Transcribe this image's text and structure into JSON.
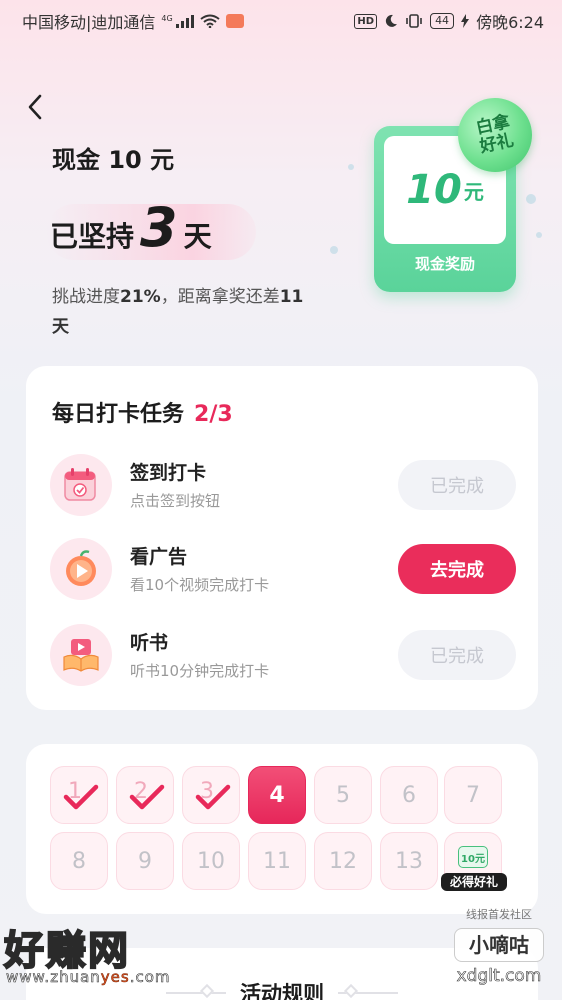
{
  "status_bar": {
    "carrier": "中国移动|迪加通信",
    "network": "4G",
    "hd": "HD",
    "battery": "44",
    "time": "傍晚6:24"
  },
  "header": {
    "title": "现金 10 元",
    "persist_prefix": "已坚持",
    "persist_days": "3",
    "persist_suffix": "天",
    "progress_label": "挑战进度",
    "progress_value": "21%",
    "progress_mid": "，距离拿奖还差",
    "days_left": "11",
    "days_unit": "天"
  },
  "reward": {
    "amount": "10",
    "unit": "元",
    "label": "现金奖励",
    "stamp": "白拿好礼"
  },
  "tasks": {
    "title": "每日打卡任务",
    "count": "2/3",
    "items": [
      {
        "name": "签到打卡",
        "desc": "点击签到按钮",
        "button": "已完成",
        "done": true,
        "icon": "calendar-icon"
      },
      {
        "name": "看广告",
        "desc": "看10个视频完成打卡",
        "button": "去完成",
        "done": false,
        "icon": "video-play-icon"
      },
      {
        "name": "听书",
        "desc": "听书10分钟完成打卡",
        "button": "已完成",
        "done": true,
        "icon": "book-icon"
      }
    ]
  },
  "calendar": {
    "days": [
      "1",
      "2",
      "3",
      "4",
      "5",
      "6",
      "7",
      "8",
      "9",
      "10",
      "11",
      "12",
      "13"
    ],
    "checked_days": 3,
    "today": "4",
    "final_gift": {
      "amount": "10元",
      "label": "必得好礼"
    }
  },
  "rules": {
    "title": "活动规则"
  },
  "watermarks": {
    "left_logo": "好赚网",
    "left_url_a": "www.zhuan",
    "left_url_b": "yes",
    "left_url_c": ".com",
    "right_small": "线报首发社区",
    "right_box": "小嘀咕",
    "right_domain": "xdglt.com"
  },
  "colors": {
    "accent": "#e8295a",
    "reward_green": "#5ad39a",
    "done_button": "#f2f3f7"
  }
}
